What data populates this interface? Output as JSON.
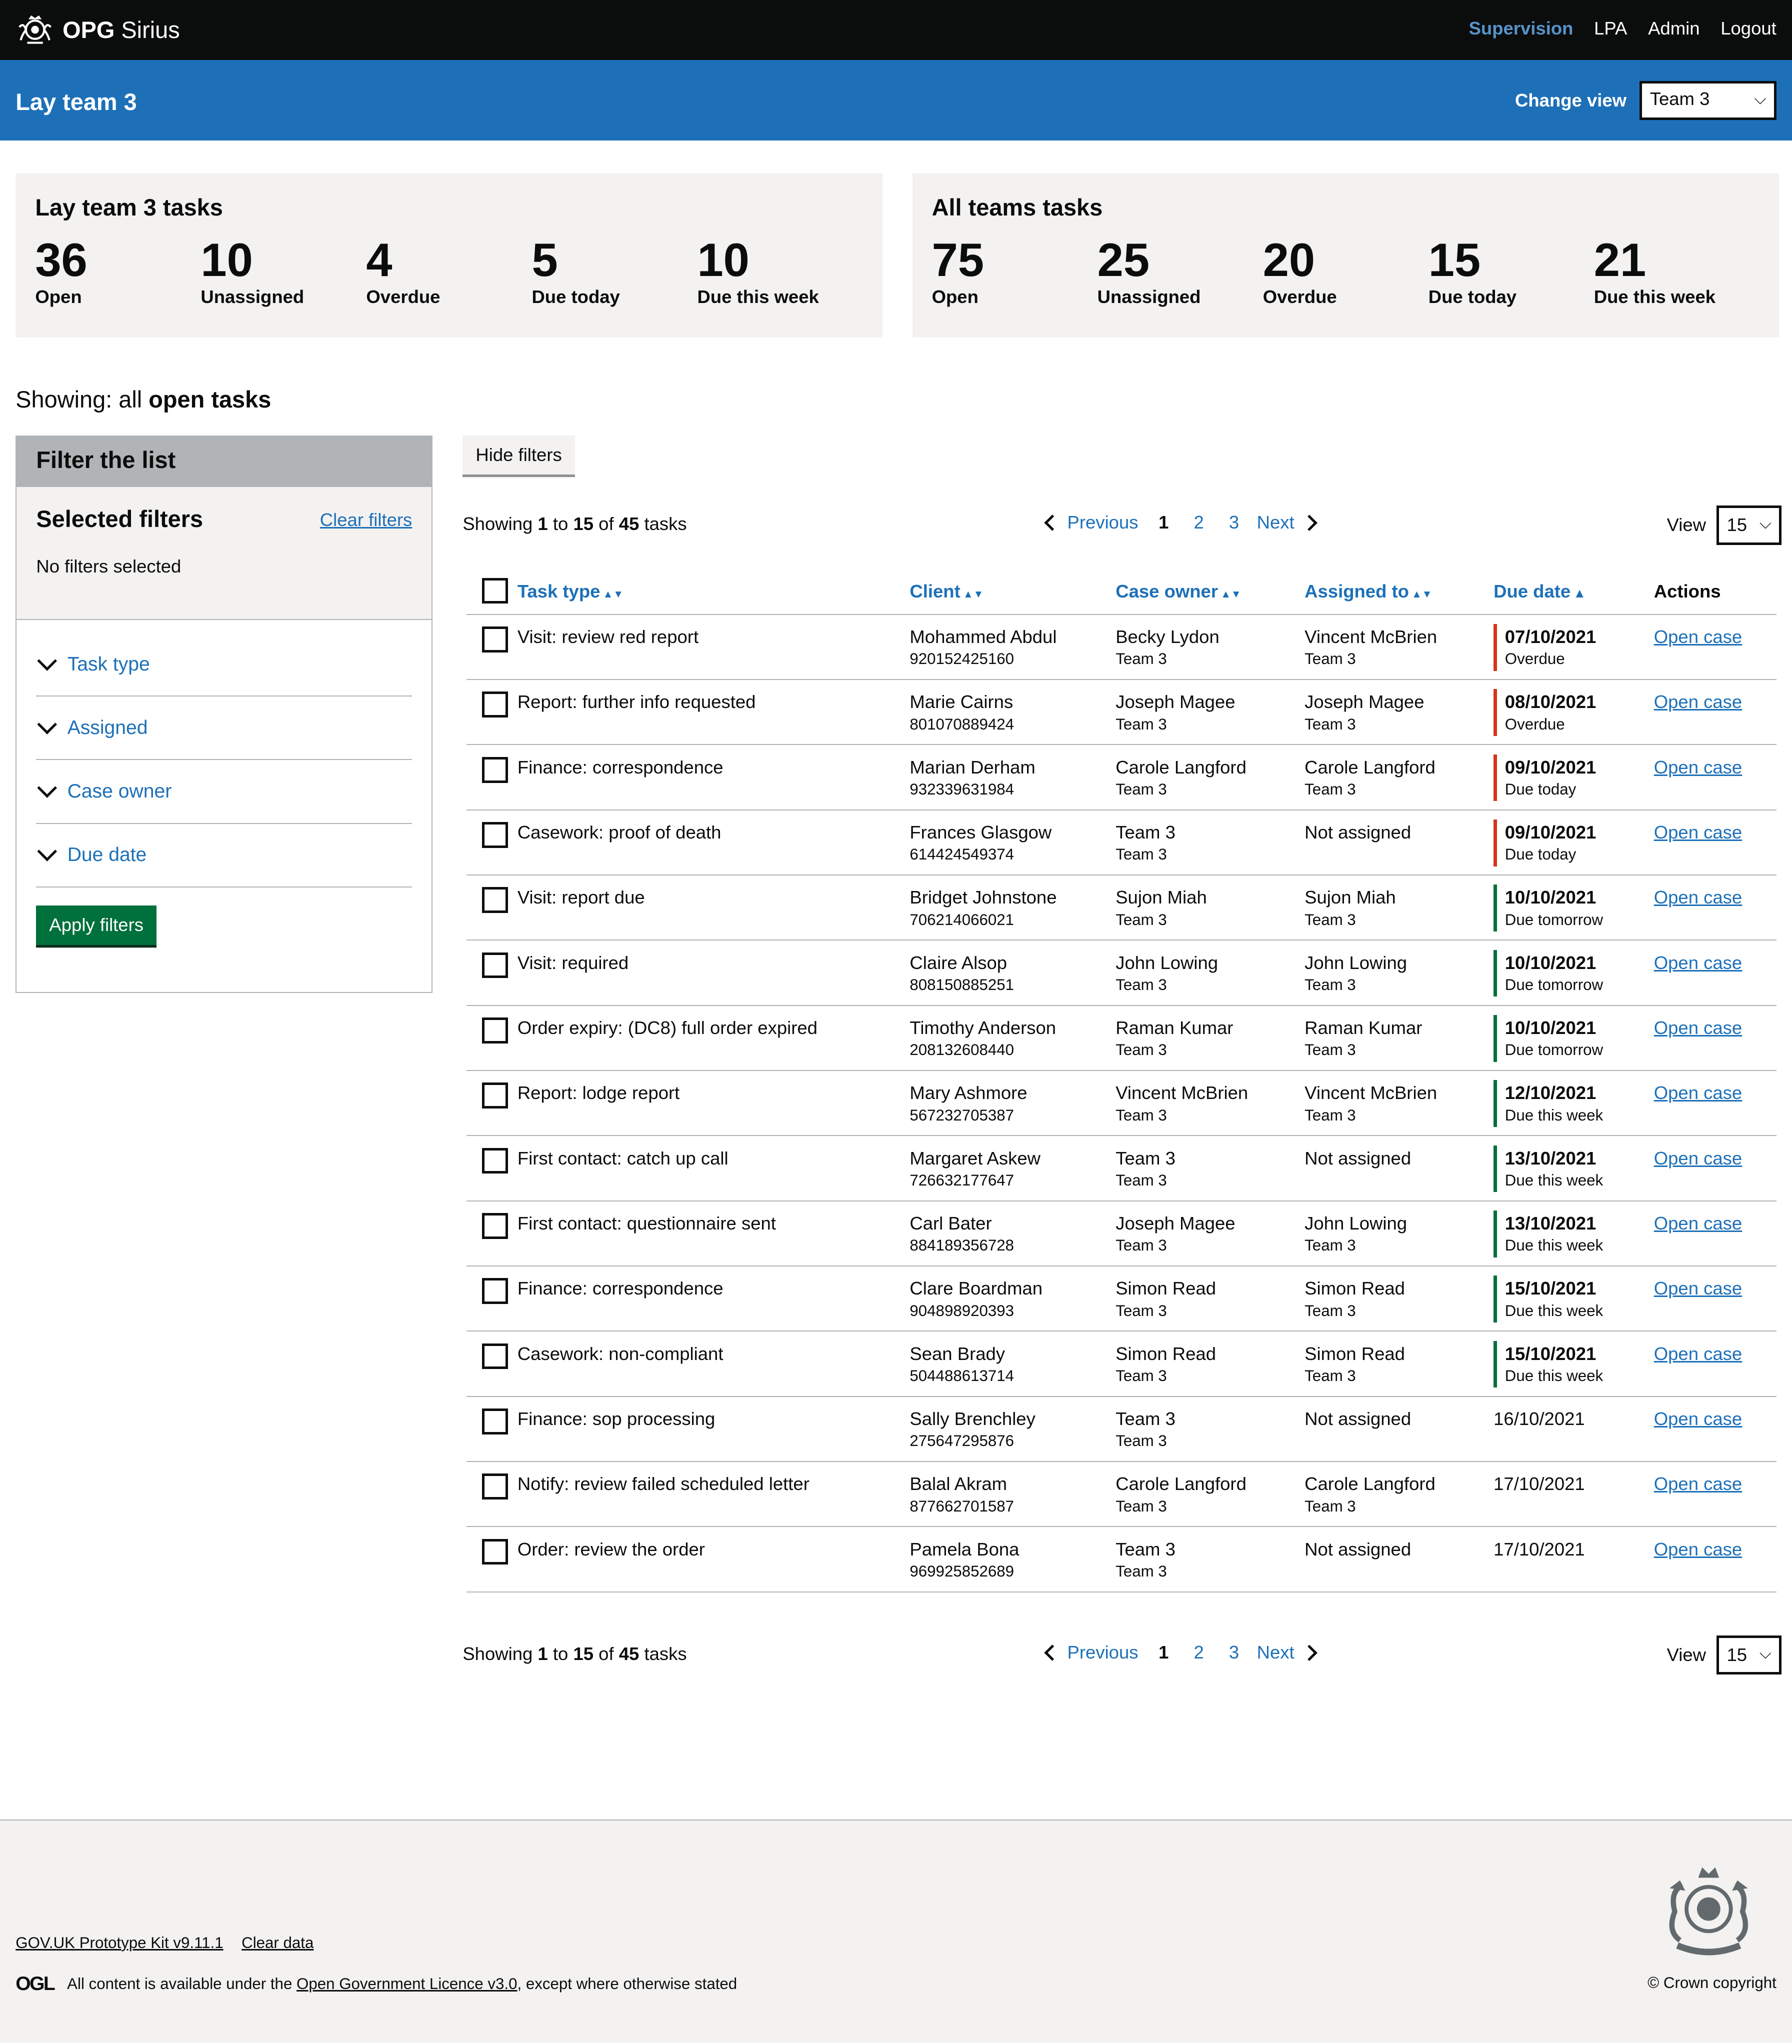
{
  "header": {
    "brand_bold": "OPG",
    "brand_name": "Sirius",
    "nav": [
      "Supervision",
      "LPA",
      "Admin",
      "Logout"
    ]
  },
  "team_bar": {
    "title": "Lay team 3",
    "change_view_label": "Change view",
    "selected_team": "Team 3"
  },
  "team_summary": {
    "title": "Lay team 3 tasks",
    "stats": [
      {
        "value": "36",
        "label": "Open"
      },
      {
        "value": "10",
        "label": "Unassigned"
      },
      {
        "value": "4",
        "label": "Overdue"
      },
      {
        "value": "5",
        "label": "Due today"
      },
      {
        "value": "10",
        "label": "Due this week"
      }
    ]
  },
  "all_summary": {
    "title": "All teams tasks",
    "stats": [
      {
        "value": "75",
        "label": "Open"
      },
      {
        "value": "25",
        "label": "Unassigned"
      },
      {
        "value": "20",
        "label": "Overdue"
      },
      {
        "value": "15",
        "label": "Due today"
      },
      {
        "value": "21",
        "label": "Due this week"
      }
    ]
  },
  "showing_heading": {
    "prefix": "Showing: all",
    "bold": "open tasks"
  },
  "filter": {
    "title": "Filter the list",
    "selected_title": "Selected filters",
    "clear_label": "Clear filters",
    "none_label": "No filters selected",
    "options": [
      "Task type",
      "Assigned",
      "Case owner",
      "Due date"
    ],
    "apply_label": "Apply filters"
  },
  "hide_filters_label": "Hide filters",
  "pagination": {
    "showing_pre": "Showing",
    "from": "1",
    "to_word": "to",
    "to": "15",
    "of_word": "of",
    "total": "45",
    "unit": "tasks",
    "prev": "Previous",
    "next": "Next",
    "pages": [
      "1",
      "2",
      "3"
    ],
    "current_page": "1",
    "view_label": "View",
    "view_value": "15"
  },
  "table": {
    "headers": [
      "Task type",
      "Client",
      "Case owner",
      "Assigned to",
      "Due date",
      "Actions"
    ],
    "rows": [
      {
        "task": "Visit: review red report",
        "client": "Mohammed Abdul",
        "client_id": "920152425160",
        "owner": "Becky Lydon",
        "owner_team": "Team 3",
        "assigned": "Vincent McBrien",
        "assigned_team": "Team 3",
        "due": "07/10/2021",
        "due_status": "Overdue",
        "status_color": "#d4351c",
        "action": "Open case"
      },
      {
        "task": "Report: further info requested",
        "client": "Marie Cairns",
        "client_id": "801070889424",
        "owner": "Joseph Magee",
        "owner_team": "Team 3",
        "assigned": "Joseph Magee",
        "assigned_team": "Team 3",
        "due": "08/10/2021",
        "due_status": "Overdue",
        "status_color": "#d4351c",
        "action": "Open case"
      },
      {
        "task": "Finance: correspondence",
        "client": "Marian Derham",
        "client_id": "932339631984",
        "owner": "Carole Langford",
        "owner_team": "Team 3",
        "assigned": "Carole Langford",
        "assigned_team": "Team 3",
        "due": "09/10/2021",
        "due_status": "Due today",
        "status_color": "#d4351c",
        "action": "Open case"
      },
      {
        "task": "Casework: proof of death",
        "client": "Frances Glasgow",
        "client_id": "614424549374",
        "owner": "Team 3",
        "owner_team": "Team 3",
        "assigned": "Not assigned",
        "assigned_team": "",
        "due": "09/10/2021",
        "due_status": "Due today",
        "status_color": "#d4351c",
        "action": "Open case"
      },
      {
        "task": "Visit: report due",
        "client": "Bridget Johnstone",
        "client_id": "706214066021",
        "owner": "Sujon Miah",
        "owner_team": "Team 3",
        "assigned": "Sujon Miah",
        "assigned_team": "Team 3",
        "due": "10/10/2021",
        "due_status": "Due tomorrow",
        "status_color": "#00703c",
        "action": "Open case"
      },
      {
        "task": "Visit: required",
        "client": "Claire Alsop",
        "client_id": "808150885251",
        "owner": "John Lowing",
        "owner_team": "Team 3",
        "assigned": "John Lowing",
        "assigned_team": "Team 3",
        "due": "10/10/2021",
        "due_status": "Due tomorrow",
        "status_color": "#00703c",
        "action": "Open case"
      },
      {
        "task": "Order expiry: (DC8) full order expired",
        "client": "Timothy Anderson",
        "client_id": "208132608440",
        "owner": "Raman Kumar",
        "owner_team": "Team 3",
        "assigned": "Raman Kumar",
        "assigned_team": "Team 3",
        "due": "10/10/2021",
        "due_status": "Due tomorrow",
        "status_color": "#00703c",
        "action": "Open case"
      },
      {
        "task": "Report: lodge report",
        "client": "Mary Ashmore",
        "client_id": "567232705387",
        "owner": "Vincent McBrien",
        "owner_team": "Team 3",
        "assigned": "Vincent McBrien",
        "assigned_team": "Team 3",
        "due": "12/10/2021",
        "due_status": "Due this week",
        "status_color": "#00703c",
        "action": "Open case"
      },
      {
        "task": "First contact: catch up call",
        "client": "Margaret Askew",
        "client_id": "726632177647",
        "owner": "Team 3",
        "owner_team": "Team 3",
        "assigned": "Not assigned",
        "assigned_team": "",
        "due": "13/10/2021",
        "due_status": "Due this week",
        "status_color": "#00703c",
        "action": "Open case"
      },
      {
        "task": "First contact: questionnaire sent",
        "client": "Carl Bater",
        "client_id": "884189356728",
        "owner": "Joseph Magee",
        "owner_team": "Team 3",
        "assigned": "John Lowing",
        "assigned_team": "Team 3",
        "due": "13/10/2021",
        "due_status": "Due this week",
        "status_color": "#00703c",
        "action": "Open case"
      },
      {
        "task": "Finance: correspondence",
        "client": "Clare Boardman",
        "client_id": "904898920393",
        "owner": "Simon Read",
        "owner_team": "Team 3",
        "assigned": "Simon Read",
        "assigned_team": "Team 3",
        "due": "15/10/2021",
        "due_status": "Due this week",
        "status_color": "#00703c",
        "action": "Open case"
      },
      {
        "task": "Casework: non-compliant",
        "client": "Sean Brady",
        "client_id": "504488613714",
        "owner": "Simon Read",
        "owner_team": "Team 3",
        "assigned": "Simon Read",
        "assigned_team": "Team 3",
        "due": "15/10/2021",
        "due_status": "Due this week",
        "status_color": "#00703c",
        "action": "Open case"
      },
      {
        "task": "Finance: sop processing",
        "client": "Sally Brenchley",
        "client_id": "275647295876",
        "owner": "Team 3",
        "owner_team": "Team 3",
        "assigned": "Not assigned",
        "assigned_team": "",
        "due": "16/10/2021",
        "due_status": "",
        "status_color": "",
        "action": "Open case"
      },
      {
        "task": "Notify: review failed scheduled letter",
        "client": "Balal Akram",
        "client_id": "877662701587",
        "owner": "Carole Langford",
        "owner_team": "Team 3",
        "assigned": "Carole Langford",
        "assigned_team": "Team 3",
        "due": "17/10/2021",
        "due_status": "",
        "status_color": "",
        "action": "Open case"
      },
      {
        "task": "Order: review the order",
        "client": "Pamela Bona",
        "client_id": "969925852689",
        "owner": "Team 3",
        "owner_team": "Team 3",
        "assigned": "Not assigned",
        "assigned_team": "",
        "due": "17/10/2021",
        "due_status": "",
        "status_color": "",
        "action": "Open case"
      }
    ]
  },
  "footer": {
    "links": [
      "GOV.UK Prototype Kit v9.11.1",
      "Clear data"
    ],
    "ogl": "OGL",
    "licence_pre": "All content is available under the",
    "licence_link": "Open Government Licence v3.0",
    "licence_post": ", except where otherwise stated",
    "copyright": "© Crown copyright"
  }
}
